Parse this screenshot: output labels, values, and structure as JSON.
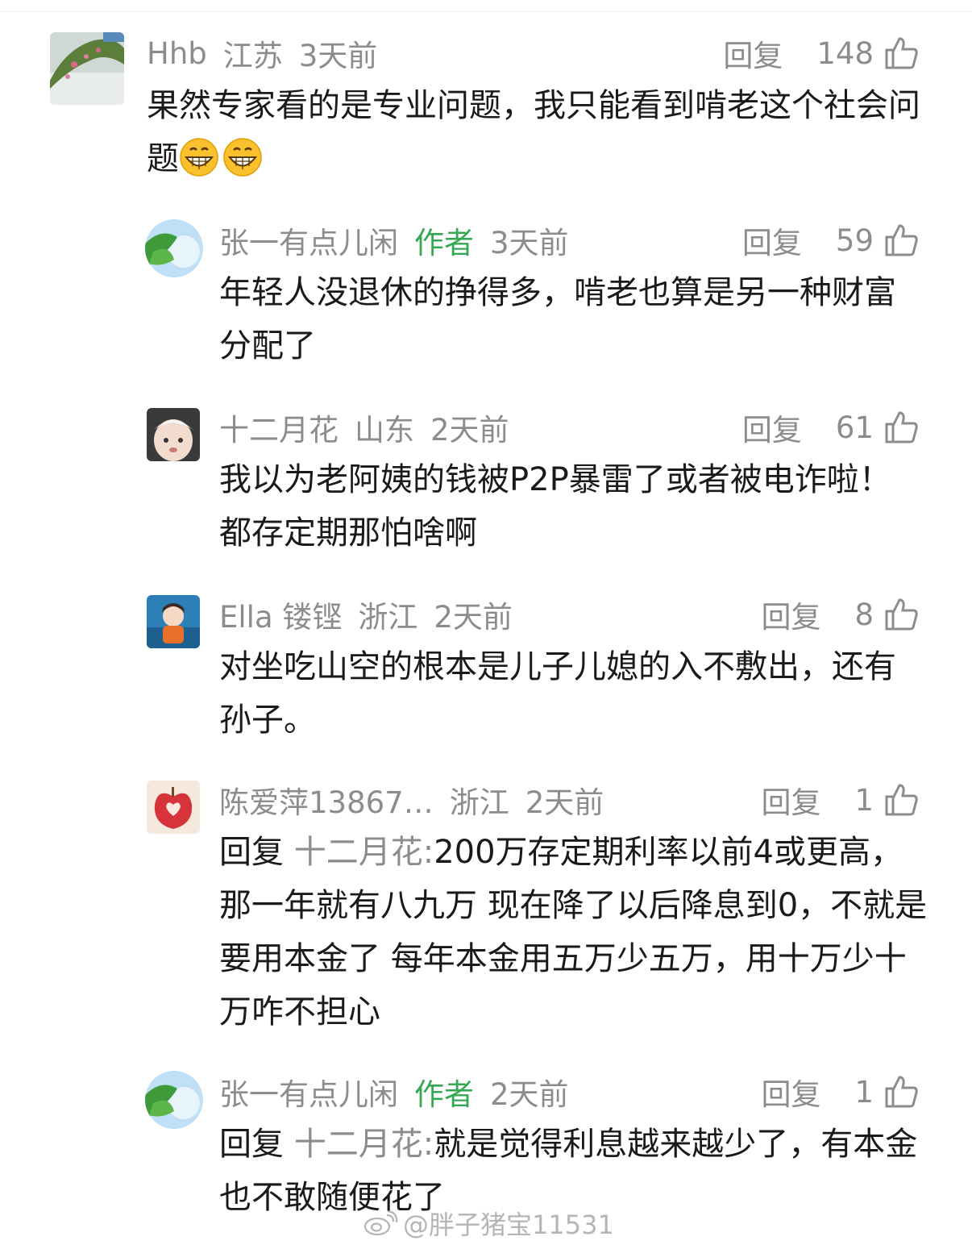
{
  "comments": [
    {
      "user": "Hhb",
      "location": "江苏",
      "time": "3天前",
      "reply_label": "回复",
      "likes": "148",
      "text": "果然专家看的是专业问题，我只能看到啃老这个社会问题",
      "emoji_icons": [
        "grin-emoji-icon",
        "grin-emoji-icon"
      ]
    },
    {
      "user": "张一有点儿闲",
      "author_tag": "作者",
      "time": "3天前",
      "reply_label": "回复",
      "likes": "59",
      "text": "年轻人没退休的挣得多，啃老也算是另一种财富分配了"
    },
    {
      "user": "十二月花",
      "location": "山东",
      "time": "2天前",
      "reply_label": "回复",
      "likes": "61",
      "text": "我以为老阿姨的钱被P2P暴雷了或者被电诈啦！都存定期那怕啥啊"
    },
    {
      "user": "Ella 镂铿",
      "location": "浙江",
      "time": "2天前",
      "reply_label": "回复",
      "likes": "8",
      "text": "对坐吃山空的根本是儿子儿媳的入不敷出，还有孙子。"
    },
    {
      "user": "陈爱萍13867…",
      "location": "浙江",
      "time": "2天前",
      "reply_label": "回复",
      "likes": "1",
      "reply_prefix": "回复 ",
      "reply_to": "十二月花:",
      "text": "200万存定期利率以前4或更高，那一年就有八九万 现在降了以后降息到0，不就是要用本金了 每年本金用五万少五万，用十万少十万咋不担心"
    },
    {
      "user": "张一有点儿闲",
      "author_tag": "作者",
      "time": "2天前",
      "reply_label": "回复",
      "likes": "1",
      "reply_prefix": "回复 ",
      "reply_to": "十二月花:",
      "text": "就是觉得利息越来越少了，有本金也不敢随便花了"
    }
  ],
  "watermark": "@胖子猪宝11531",
  "colors": {
    "meta_gray": "#8c8c8c",
    "author_green": "#34a853",
    "text": "#1a1a1a"
  }
}
